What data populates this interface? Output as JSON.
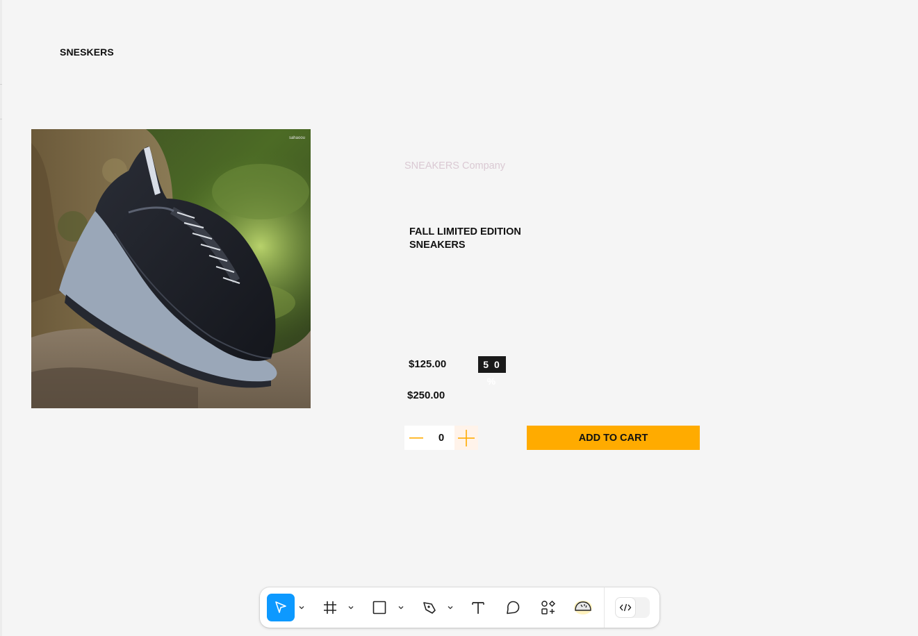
{
  "header": {
    "brand": "SNESKERS"
  },
  "product": {
    "image_alt": "Black suede hiking sneaker leaning on a mossy rock",
    "watermark": "sahaoou",
    "company": "SNEAKERS Company",
    "title": "FALL LIMITED EDITION SNEAKERS",
    "price_current": "$125.00",
    "discount": "5 0 %",
    "price_original": "$250.00"
  },
  "cart": {
    "quantity": "0",
    "add_label": "ADD TO CART"
  },
  "toolbar": {
    "tools": [
      "move-tool",
      "frame-tool",
      "shape-tool",
      "pen-tool",
      "text-tool",
      "comment-tool",
      "actions-tool",
      "plugin-tool"
    ],
    "active_tool": "move-tool",
    "dev_mode": false
  },
  "colors": {
    "accent": "#ffab00",
    "toolbar_active": "#0d99ff",
    "badge_bg": "#1a1a1a",
    "company_text": "#dac9d3"
  }
}
